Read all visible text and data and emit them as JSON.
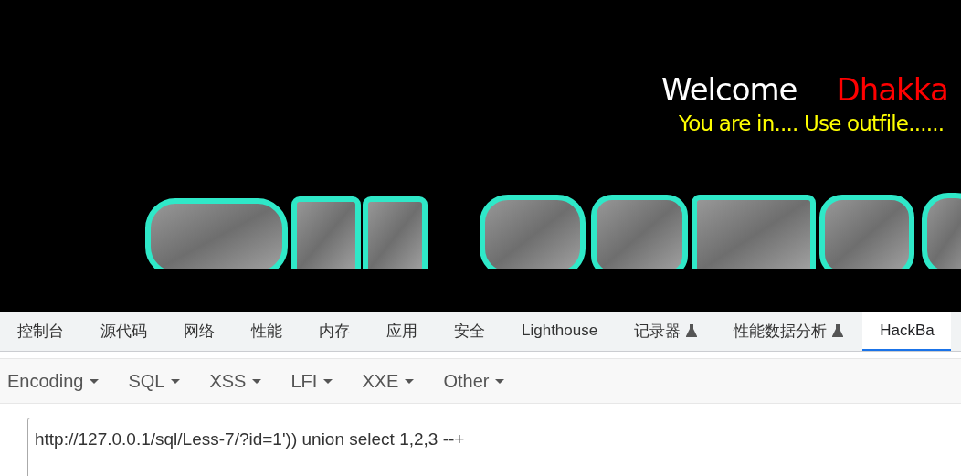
{
  "page": {
    "welcome": "Welcome",
    "user": "Dhakka",
    "message": "You are in.... Use outfile......"
  },
  "devtools": {
    "tabs": [
      {
        "label": "控制台",
        "selected": false,
        "experimental": false
      },
      {
        "label": "源代码",
        "selected": false,
        "experimental": false
      },
      {
        "label": "网络",
        "selected": false,
        "experimental": false
      },
      {
        "label": "性能",
        "selected": false,
        "experimental": false
      },
      {
        "label": "内存",
        "selected": false,
        "experimental": false
      },
      {
        "label": "应用",
        "selected": false,
        "experimental": false
      },
      {
        "label": "安全",
        "selected": false,
        "experimental": false
      },
      {
        "label": "Lighthouse",
        "selected": false,
        "experimental": false
      },
      {
        "label": "记录器",
        "selected": false,
        "experimental": true
      },
      {
        "label": "性能数据分析",
        "selected": false,
        "experimental": true
      },
      {
        "label": "HackBa",
        "selected": true,
        "experimental": false
      }
    ]
  },
  "hackbar": {
    "menus": [
      "Encoding",
      "SQL",
      "XSS",
      "LFI",
      "XXE",
      "Other"
    ],
    "url": "http://127.0.0.1/sql/Less-7/?id=1')) union select 1,2,3 --+"
  }
}
